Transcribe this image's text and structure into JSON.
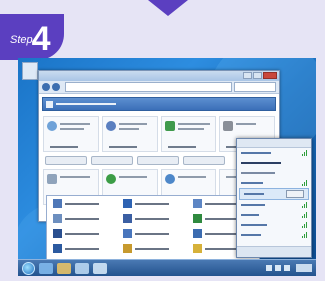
{
  "step": {
    "label": "Step",
    "number": "4"
  },
  "colors": {
    "brand": "#5b3fc0",
    "page_bg": "#e6e4f5",
    "desktop": "#1f7ed2",
    "taskbar": "#2f64a6",
    "signal": "#2f9e3c"
  },
  "icons": {
    "start": "start-orb-icon",
    "network": "wifi-signal-icon",
    "window_close": "close-icon"
  }
}
